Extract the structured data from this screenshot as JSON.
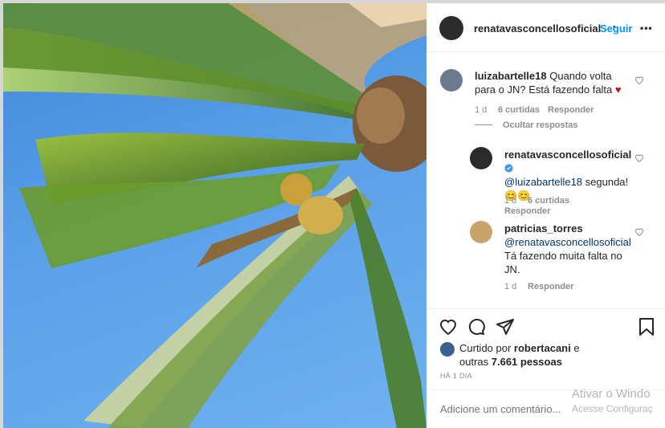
{
  "header": {
    "username": "renatavasconcellosoficial",
    "follow_label": "Seguir",
    "dot": "•",
    "more": "•••"
  },
  "comments": [
    {
      "user": "luizabartelle18",
      "text": "Quando volta para o JN? Está fazendo falta",
      "emoji": "♥",
      "age": "1 d",
      "likes": "6 curtidas",
      "reply": "Responder",
      "hide_replies": "Ocultar respostas"
    },
    {
      "user": "renatavasconcellosoficial",
      "mention": "@luizabartelle18",
      "text": " segunda!",
      "emoji": "😊😊",
      "age": "1 d",
      "likes": "6 curtidas",
      "reply": "Responder"
    },
    {
      "user": "patricias_torres",
      "mention": "@renatavasconcellosoficial",
      "text": "Tá fazendo muita falta no JN.",
      "age": "1 d",
      "reply": "Responder"
    }
  ],
  "likes": {
    "prefix": "Curtido por ",
    "by": "robertacani",
    "mid": " e",
    "line2a": "outras ",
    "count": "7.661 pessoas"
  },
  "time_ago": "HÁ 1 DIA",
  "add_comment": {
    "placeholder": "Adicione um comentário..."
  },
  "watermark": {
    "line1": "Ativar o Windo",
    "line2": "Acesse Configuraç"
  },
  "colors": {
    "accent": "#0095f6",
    "verified": "#3897f0",
    "text": "#262626",
    "muted": "#8e8e8e"
  }
}
